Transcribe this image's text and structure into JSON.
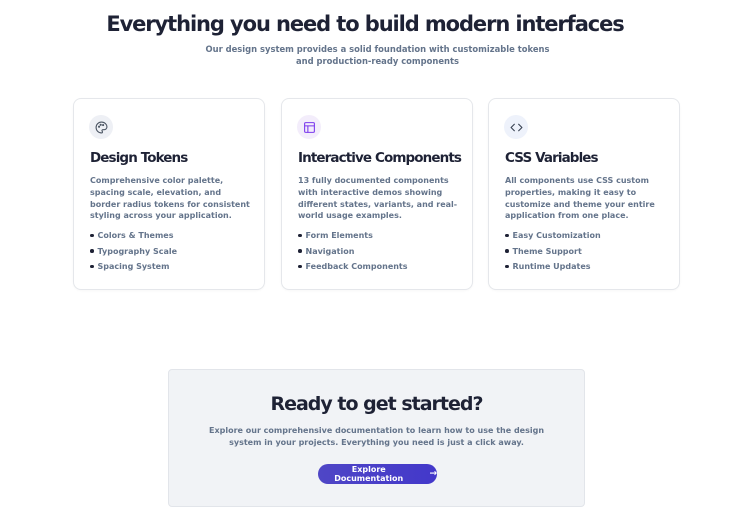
{
  "hero": {
    "title": "Everything you need to build modern interfaces",
    "subtitle": "Our design system provides a solid foundation with customizable tokens and production-ready components"
  },
  "features": [
    {
      "icon": "palette-icon",
      "icon_bg": "#eef0f5",
      "icon_color": "#4b5563",
      "title": "Design Tokens",
      "description": "Comprehensive color palette, spacing scale, elevation, and border radius tokens for consistent styling across your application.",
      "items": [
        "Colors & Themes",
        "Typography Scale",
        "Spacing System"
      ]
    },
    {
      "icon": "layout-icon",
      "icon_bg": "#f3edfb",
      "icon_color": "#7c3aed",
      "title": "Interactive Components",
      "description": "13 fully documented components with interactive demos showing different states, variants, and real-world usage examples.",
      "items": [
        "Form Elements",
        "Navigation",
        "Feedback Components"
      ]
    },
    {
      "icon": "code-icon",
      "icon_bg": "#eef2fb",
      "icon_color": "#374151",
      "title": "CSS Variables",
      "description": "All components use CSS custom properties, making it easy to customize and theme your entire application from one place.",
      "items": [
        "Easy Customization",
        "Theme Support",
        "Runtime Updates"
      ]
    }
  ],
  "cta": {
    "title": "Ready to get started?",
    "description": "Explore our comprehensive documentation to learn how to use the design system in your projects. Everything you need is just a click away.",
    "button_label": "Explore Documentation",
    "button_icon": "arrow-right-icon"
  }
}
